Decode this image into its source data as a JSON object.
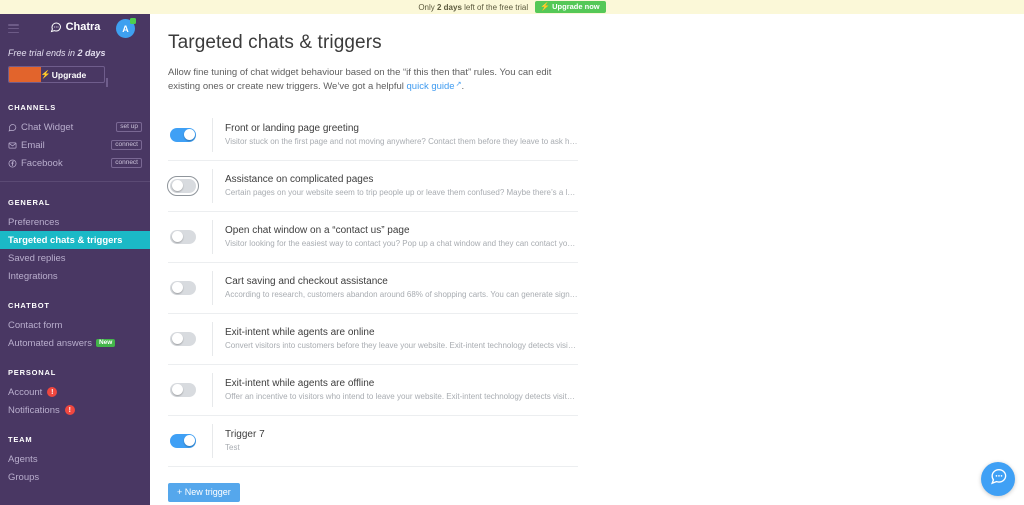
{
  "banner": {
    "text_before": "Only ",
    "text_bold": "2 days",
    "text_after": " left of the free trial",
    "upgrade_label": "Upgrade now",
    "bg_color": "#fbf8d8",
    "button_color": "#55c857"
  },
  "sidebar": {
    "brand": "Chatra",
    "avatar_initial": "A",
    "trial_note_before": "Free trial ends in ",
    "trial_note_bold": "2 days",
    "upgrade_label": "Upgrade",
    "bg_color": "#493763",
    "active_color": "#1bb9c6",
    "groups": [
      {
        "heading": "CHANNELS",
        "items": [
          {
            "label": "Chat Widget",
            "icon": "chat-bubble-icon",
            "pill": "set up",
            "active": false
          },
          {
            "label": "Email",
            "icon": "envelope-icon",
            "pill": "connect",
            "active": false
          },
          {
            "label": "Facebook",
            "icon": "facebook-icon",
            "pill": "connect",
            "active": false
          }
        ]
      },
      {
        "heading": "GENERAL",
        "items": [
          {
            "label": "Preferences",
            "active": false
          },
          {
            "label": "Targeted chats & triggers",
            "active": true
          },
          {
            "label": "Saved replies",
            "active": false
          },
          {
            "label": "Integrations",
            "active": false
          }
        ]
      },
      {
        "heading": "CHATBOT",
        "items": [
          {
            "label": "Contact form",
            "active": false
          },
          {
            "label": "Automated answers",
            "badge_new": "New",
            "active": false
          }
        ]
      },
      {
        "heading": "PERSONAL",
        "items": [
          {
            "label": "Account",
            "badge_count": "!",
            "active": false
          },
          {
            "label": "Notifications",
            "badge_count": "!",
            "active": false
          }
        ]
      },
      {
        "heading": "TEAM",
        "items": [
          {
            "label": "Agents",
            "active": false
          },
          {
            "label": "Groups",
            "active": false
          }
        ]
      }
    ]
  },
  "main": {
    "title": "Targeted chats & triggers",
    "desc_before": "Allow fine tuning of chat widget behaviour based on the “if this then that” rules. You can edit existing ones or create new triggers. We’ve got a helpful ",
    "desc_link": "quick guide",
    "desc_after": ".",
    "new_trigger_label": "+ New trigger",
    "triggers": [
      {
        "title": "Front or landing page greeting",
        "desc": "Visitor stuck on the first page and not moving anywhere? Contact them before they leave to ask how can you hel...",
        "enabled": true,
        "focused": false
      },
      {
        "title": "Assistance on complicated pages",
        "desc": "Certain pages on your website seem to trip people up or leave them confused? Maybe there’s a long form visitor...",
        "enabled": false,
        "focused": true
      },
      {
        "title": "Open chat window on a “contact us” page",
        "desc": "Visitor looking for the easiest way to contact you? Pop up a chat window and they can contact you in a breeze, ra...",
        "enabled": false,
        "focused": false
      },
      {
        "title": "Cart saving and checkout assistance",
        "desc": "According to research, customers abandon around 68% of shopping carts. You can generate significantly more o...",
        "enabled": false,
        "focused": false
      },
      {
        "title": "Exit-intent while agents are online",
        "desc": "Convert visitors into customers before they leave your website. Exit-intent technology detects visitor behavior, al...",
        "enabled": false,
        "focused": false
      },
      {
        "title": "Exit-intent while agents are offline",
        "desc": "Offer an incentive to visitors who intend to leave your website. Exit-intent technology detects visitor behavior, all...",
        "enabled": false,
        "focused": false
      },
      {
        "title": "Trigger 7",
        "desc": "Test",
        "enabled": true,
        "focused": false
      }
    ]
  },
  "chat_widget": {
    "icon": "chat-bubble-icon",
    "color": "#3fa0f5"
  }
}
